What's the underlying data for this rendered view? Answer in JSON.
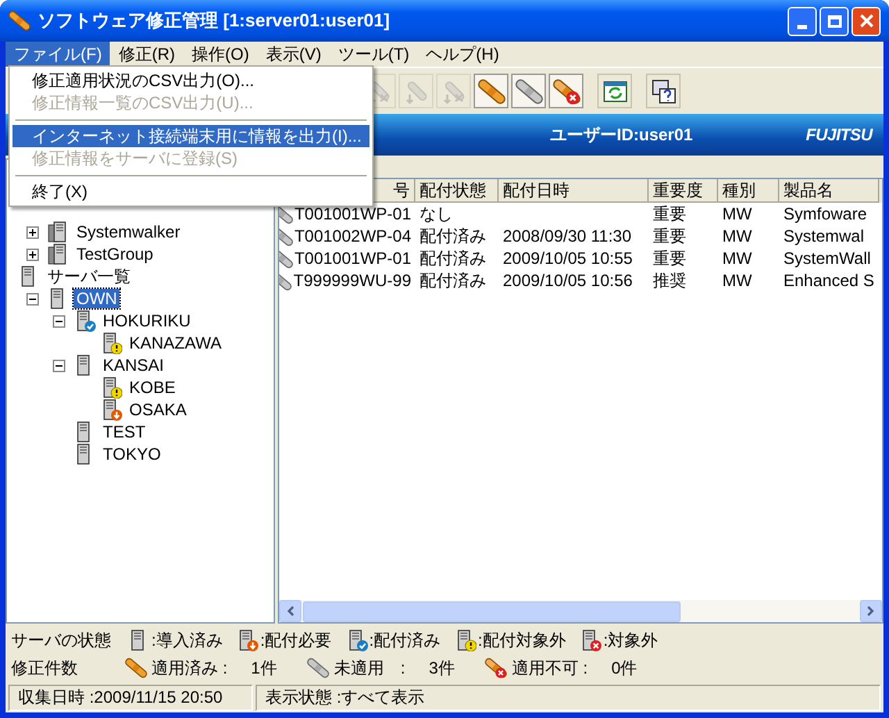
{
  "window": {
    "title": "ソフトウェア修正管理 [1:server01:user01]"
  },
  "menu_bar": [
    {
      "label": "ファイル(F)",
      "selected": true
    },
    {
      "label": "修正(R)",
      "selected": false
    },
    {
      "label": "操作(O)",
      "selected": false
    },
    {
      "label": "表示(V)",
      "selected": false
    },
    {
      "label": "ツール(T)",
      "selected": false
    },
    {
      "label": "ヘルプ(H)",
      "selected": false
    }
  ],
  "file_menu": [
    {
      "kind": "item",
      "label": "修正適用状況のCSV出力(O)...",
      "disabled": false,
      "selected": false
    },
    {
      "kind": "item",
      "label": "修正情報一覧のCSV出力(U)...",
      "disabled": true,
      "selected": false
    },
    {
      "kind": "separator"
    },
    {
      "kind": "item",
      "label": "インターネット接続端末用に情報を出力(I)...",
      "disabled": false,
      "selected": true
    },
    {
      "kind": "item",
      "label": "修正情報をサーバに登録(S)",
      "disabled": true,
      "selected": false
    },
    {
      "kind": "separator"
    },
    {
      "kind": "item",
      "label": "終了(X)",
      "disabled": false,
      "selected": false
    }
  ],
  "toolbar": [
    {
      "kind": "deliver",
      "disabled": true,
      "pressed": false
    },
    {
      "kind": "apply",
      "disabled": true,
      "pressed": false
    },
    {
      "kind": "remove",
      "disabled": true,
      "pressed": false
    },
    {
      "kind": "applied",
      "disabled": false,
      "pressed": true
    },
    {
      "kind": "unapplied",
      "disabled": false,
      "pressed": true
    },
    {
      "kind": "notapplicable",
      "disabled": false,
      "pressed": true
    },
    {
      "kind": "refresh",
      "disabled": false,
      "pressed": false
    },
    {
      "kind": "help",
      "disabled": false,
      "pressed": false
    }
  ],
  "banner": {
    "user": "ユーザーID:user01",
    "logo": "FUJITSU"
  },
  "tree": [
    {
      "label": "Systemwalker",
      "kind": "group",
      "expanded": false,
      "selected": false
    },
    {
      "label": "TestGroup",
      "kind": "group",
      "expanded": false,
      "selected": false
    },
    {
      "label": "サーバ一覧",
      "kind": "installed",
      "selected": false,
      "children": [
        {
          "label": "OWN",
          "kind": "installed",
          "expanded": true,
          "selected": true,
          "children": [
            {
              "label": "HOKURIKU",
              "kind": "distributed",
              "expanded": true,
              "selected": false,
              "children": [
                {
                  "label": "KANAZAWA",
                  "kind": "excluded",
                  "selected": false
                }
              ]
            },
            {
              "label": "KANSAI",
              "kind": "installed",
              "expanded": true,
              "selected": false,
              "children": [
                {
                  "label": "KOBE",
                  "kind": "excluded",
                  "selected": false
                },
                {
                  "label": "OSAKA",
                  "kind": "needed",
                  "selected": false
                }
              ]
            },
            {
              "label": "TEST",
              "kind": "installed",
              "selected": false
            },
            {
              "label": "TOKYO",
              "kind": "installed",
              "selected": false
            }
          ]
        }
      ]
    }
  ],
  "table": {
    "columns": [
      "号",
      "配付状態",
      "配付日時",
      "重要度",
      "種別",
      "製品名"
    ],
    "rows": [
      {
        "kind": "unapplied",
        "cells": [
          "T001001WP-01",
          "なし",
          "",
          "重要",
          "MW",
          "Symfoware"
        ]
      },
      {
        "kind": "unapplied",
        "cells": [
          "T001002WP-04",
          "配付済み",
          "2008/09/30 11:30",
          "重要",
          "MW",
          "Systemwal"
        ]
      },
      {
        "kind": "unapplied",
        "cells": [
          "T001001WP-01",
          "配付済み",
          "2009/10/05 10:55",
          "重要",
          "MW",
          "SystemWall"
        ]
      },
      {
        "kind": "unapplied",
        "cells": [
          "T999999WU-99",
          "配付済み",
          "2009/10/05 10:56",
          "推奨",
          "MW",
          "Enhanced S"
        ]
      }
    ]
  },
  "server_legend": {
    "label": "サーバの状態",
    "items": [
      {
        "kind": "installed",
        "label": ":導入済み"
      },
      {
        "kind": "needed",
        "label": ":配付必要"
      },
      {
        "kind": "distributed",
        "label": ":配付済み"
      },
      {
        "kind": "excluded",
        "label": ":配付対象外"
      },
      {
        "kind": "notarget",
        "label": ":対象外"
      }
    ]
  },
  "patch_counts": {
    "label": "修正件数",
    "items": [
      {
        "kind": "applied",
        "label": "適用済み :",
        "count": "1件"
      },
      {
        "kind": "unapplied",
        "label": "未適用　:",
        "count": "3件"
      },
      {
        "kind": "notapplicable",
        "label": "適用不可 :",
        "count": "0件"
      }
    ]
  },
  "status_bar": [
    "収集日時 :2009/11/15 20:50",
    "表示状態 :すべて表示"
  ]
}
